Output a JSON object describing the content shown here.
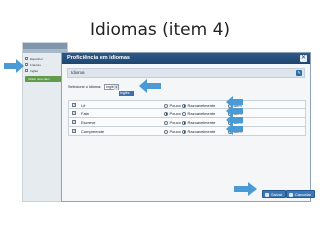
{
  "slide": {
    "title": "Idiomas (item 4)"
  },
  "background_panel": {
    "list_items": [
      "",
      "Espanhol",
      "Francês",
      "Inglês"
    ],
    "add_button_label": "Incluir novo item"
  },
  "dialog": {
    "title": "Proficiência em idiomas",
    "section_label": "Idioma",
    "select_label": "Selecione o idioma:",
    "selected_language": "Inglês",
    "dropdown_option": "Inglês",
    "rows": [
      {
        "skill": "Lê",
        "checked": true,
        "level": "Razoavelmente"
      },
      {
        "skill": "Fala",
        "checked": true,
        "level": "Pouco"
      },
      {
        "skill": "Escreve",
        "checked": true,
        "level": "Razoavelmente"
      },
      {
        "skill": "Compreende",
        "checked": true,
        "level": "Razoavelmente"
      }
    ],
    "level_labels": {
      "pouco": "Pouco",
      "razoavel": "Razoavelmente",
      "bem": "Bem"
    },
    "buttons": {
      "save": "Salvar",
      "cancel": "Cancelar"
    }
  },
  "colors": {
    "titlebar": "#1f4670",
    "accent_arrow": "#4a9ad6",
    "button": "#3d78b4"
  }
}
